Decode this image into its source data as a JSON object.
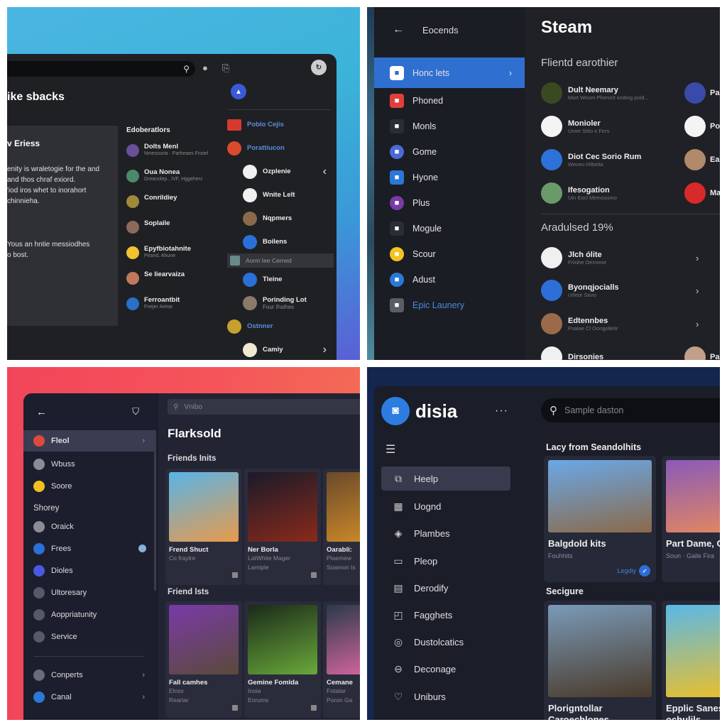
{
  "q1": {
    "search_icon": "search-icon",
    "title": "ike sbacks",
    "card": {
      "heading": "v Eriess",
      "lines": [
        "enity is wraletogie for the and",
        "and thos chraf exiord.",
        "'iod iros whet to inorahort",
        "chinnieha."
      ],
      "footer": [
        "Yous an hntie messiodhes",
        "o bost."
      ]
    },
    "middle": {
      "heading": "Edoberatlors",
      "items": [
        {
          "name": "Dolts Menl",
          "sub": "Nmessuria · Parheaes Fnsiel",
          "color": "#6a4f9a"
        },
        {
          "name": "Oua Nonea",
          "sub": "Dreanolep., IVF, Hggeherz",
          "color": "#4a8a6a"
        },
        {
          "name": "Conrildiey",
          "sub": "",
          "color": "#a08a3a"
        },
        {
          "name": "Soplaile",
          "sub": "",
          "color": "#8a6a5a"
        },
        {
          "name": "Epyfbiotahnite",
          "sub": "Pirand, Ahune",
          "color": "#f2c230"
        },
        {
          "name": "Se liearvaiza",
          "sub": "",
          "color": "#c07a5a"
        },
        {
          "name": "Ferroantbit",
          "sub": "Fnejer Aeirar",
          "color": "#2a70c8"
        }
      ]
    },
    "right": {
      "items": [
        {
          "name": "Poblo Cejis",
          "kind": "brand",
          "color": "#d63a2e"
        },
        {
          "name": "Porattiucon",
          "kind": "brand",
          "color": "#d94a2e"
        },
        {
          "name": "Ozplenie",
          "kind": "user",
          "color": "#f0f0f0"
        },
        {
          "name": "Wnite Lelt",
          "kind": "user",
          "color": "#f0f0f0"
        },
        {
          "name": "Nqpmers",
          "kind": "user",
          "color": "#8a6a4a"
        },
        {
          "name": "Boilens",
          "kind": "user",
          "color": "#2a70d8"
        },
        {
          "name": "Aorm Iee Cerned",
          "kind": "selected",
          "color": "#6a8a8a"
        },
        {
          "name": "Tleine",
          "kind": "user",
          "color": "#2a70d8"
        },
        {
          "name": "Porinding Lot",
          "sub": "Four Ihsihes",
          "kind": "user",
          "color": "#8a7a6a"
        },
        {
          "name": "Ostnner",
          "kind": "brand",
          "color": "#c8a030"
        },
        {
          "name": "Camiy",
          "kind": "user",
          "color": "#f0e8d0"
        }
      ]
    }
  },
  "q2": {
    "sidebar": {
      "header": "Eocends",
      "items": [
        {
          "label": "Honc lets",
          "color": "#ffffff",
          "active": true
        },
        {
          "label": "Phoned",
          "color": "#e0403a"
        },
        {
          "label": "Monls",
          "color": "#2a2d36"
        },
        {
          "label": "Gome",
          "color": "#4a6ad8"
        },
        {
          "label": "Hyone",
          "color": "#2a78d8"
        },
        {
          "label": "Plus",
          "color": "#7a3aa8"
        },
        {
          "label": "Mogule",
          "color": "#2a2d36"
        },
        {
          "label": "Scour",
          "color": "#f2c420"
        },
        {
          "label": "Adust",
          "color": "#2a78d8"
        },
        {
          "label": "Epic Launery",
          "color": "#5a5d66",
          "accent": true
        }
      ]
    },
    "main": {
      "title": "Steam",
      "section1": "Flientd earothier",
      "friends": [
        {
          "name": "Dult Neemary",
          "sub": "Mort Wosm Pherorit sroting poid...",
          "color": "#3a4a20"
        },
        {
          "name": "Monioler",
          "sub": "Umer Sitio o Fers",
          "color": "#f4f4f4"
        },
        {
          "name": "Diot Cec Sorio Rum",
          "sub": "Wecev-/rlibeita",
          "color": "#2d72d8"
        },
        {
          "name": "Ifesogation",
          "sub": "Uin Eocl Memssumo",
          "color": "#6a9a6a"
        }
      ],
      "friends_right": [
        {
          "name": "Pa",
          "color": "#3a4aa8"
        },
        {
          "name": "Po",
          "color": "#f4f4f4"
        },
        {
          "name": "Ea",
          "color": "#b08a6a"
        },
        {
          "name": "Ma",
          "color": "#d82a2a"
        }
      ],
      "section2": "Aradulsed 19%",
      "list": [
        {
          "name": "Jlch ólite",
          "sub": "Frlsihe Oernmor",
          "color": "#f0f0f0"
        },
        {
          "name": "Byonqjocialls",
          "sub": "Urleor Sioro",
          "color": "#2d6fd8"
        },
        {
          "name": "Edtennbes",
          "sub": "Fnaiae Cl Oongolletir",
          "color": "#9a6a4a"
        },
        {
          "name": "Dirsonies",
          "sub": "",
          "color": "#f0f0f0"
        }
      ],
      "list_right_partial": {
        "name": "Pa",
        "color": "#c0a08a"
      }
    }
  },
  "q3": {
    "sidebar": {
      "items_top": [
        {
          "label": "Fleol",
          "color": "#e04a3a",
          "active": true
        },
        {
          "label": "Wbuss",
          "color": "#8a8d96"
        },
        {
          "label": "Soore",
          "color": "#f2c020"
        }
      ],
      "group_label": "Shorey",
      "items_group": [
        {
          "label": "Oraick",
          "color": "#8a8d96"
        },
        {
          "label": "Frees",
          "color": "#2a70d8",
          "badge": true
        },
        {
          "label": "Dioles",
          "color": "#4a5ae0"
        },
        {
          "label": "Ultoresary",
          "color": "#555a66"
        },
        {
          "label": "Aoppriatunity",
          "color": "#555a66"
        },
        {
          "label": "Service",
          "color": "#555a66"
        }
      ],
      "items_bottom": [
        {
          "label": "Conperts",
          "color": "#6a6d78"
        },
        {
          "label": "Canal",
          "color": "#2a78d8"
        }
      ]
    },
    "main": {
      "search_placeholder": "Vnibo",
      "title": "Flarksold",
      "section1": "Friends Inits",
      "row1": [
        {
          "title": "Frend Shuct",
          "sub1": "Co fraytre",
          "sub2": "",
          "art": [
            "#58b4e8",
            "#e89a4a"
          ]
        },
        {
          "title": "Ner Borla",
          "sub1": "LatWhite Mager",
          "sub2": "Lamiple",
          "art": [
            "#1a1a2a",
            "#8a2a1a"
          ]
        },
        {
          "title": "Oarabli:",
          "sub1": "Plaemew",
          "sub2": "Soamon ts",
          "art": [
            "#6a4a2a",
            "#d8902a"
          ]
        }
      ],
      "section2": "Friend lsts",
      "row2": [
        {
          "title": "Fall camhes",
          "sub1": "Elnsx",
          "sub2": "Reariar",
          "art": [
            "#7a3aa8",
            "#5a4a3a"
          ]
        },
        {
          "title": "Gemine Fomlda",
          "sub1": "Inoia",
          "sub2": "Eorums",
          "art": [
            "#1a2a1a",
            "#6aa83a"
          ]
        },
        {
          "title": "Cemane",
          "sub1": "Fotatar",
          "sub2": "Poron Ga",
          "art": [
            "#2a3a4a",
            "#e86aa8"
          ]
        }
      ]
    }
  },
  "q4": {
    "brand": "disia",
    "search_placeholder": "Sample daston",
    "sidebar": [
      {
        "label": "Heelp",
        "icon": "monitor-icon",
        "glyph": "⧉",
        "active": true
      },
      {
        "label": "Uognd",
        "icon": "music-icon",
        "glyph": "▦"
      },
      {
        "label": "Plambes",
        "icon": "tag-icon",
        "glyph": "◈"
      },
      {
        "label": "Pleop",
        "icon": "image-icon",
        "glyph": "▭"
      },
      {
        "label": "Derodify",
        "icon": "clipboard-icon",
        "glyph": "▤"
      },
      {
        "label": "Fagghets",
        "icon": "chart-icon",
        "glyph": "◰"
      },
      {
        "label": "Dustolcatics",
        "icon": "target-icon",
        "glyph": "◎"
      },
      {
        "label": "Deconage",
        "icon": "circle-icon",
        "glyph": "⊖"
      },
      {
        "label": "Uniburs",
        "icon": "heart-icon",
        "glyph": "♡"
      }
    ],
    "section1": "Lacy from Seandolhits",
    "row1": [
      {
        "title": "Balgdold kits",
        "sub": "Fouhhits",
        "tag": "Legdiy",
        "art": [
          "#6aa8e8",
          "#8a6a4a"
        ]
      },
      {
        "title": "Part Dame, CoentHints",
        "sub": "Soun · Gaile Fira",
        "art": [
          "#8a5ab8",
          "#e88a5a"
        ]
      }
    ],
    "section2": "Secigure",
    "row2": [
      {
        "title": "Plorigntollar Caroechlones",
        "art": [
          "#7a9ab8",
          "#4a3a2a"
        ]
      },
      {
        "title": "Epplic Sanes Lnal ochulils",
        "art": [
          "#5ab8e8",
          "#f2c020"
        ]
      }
    ]
  }
}
